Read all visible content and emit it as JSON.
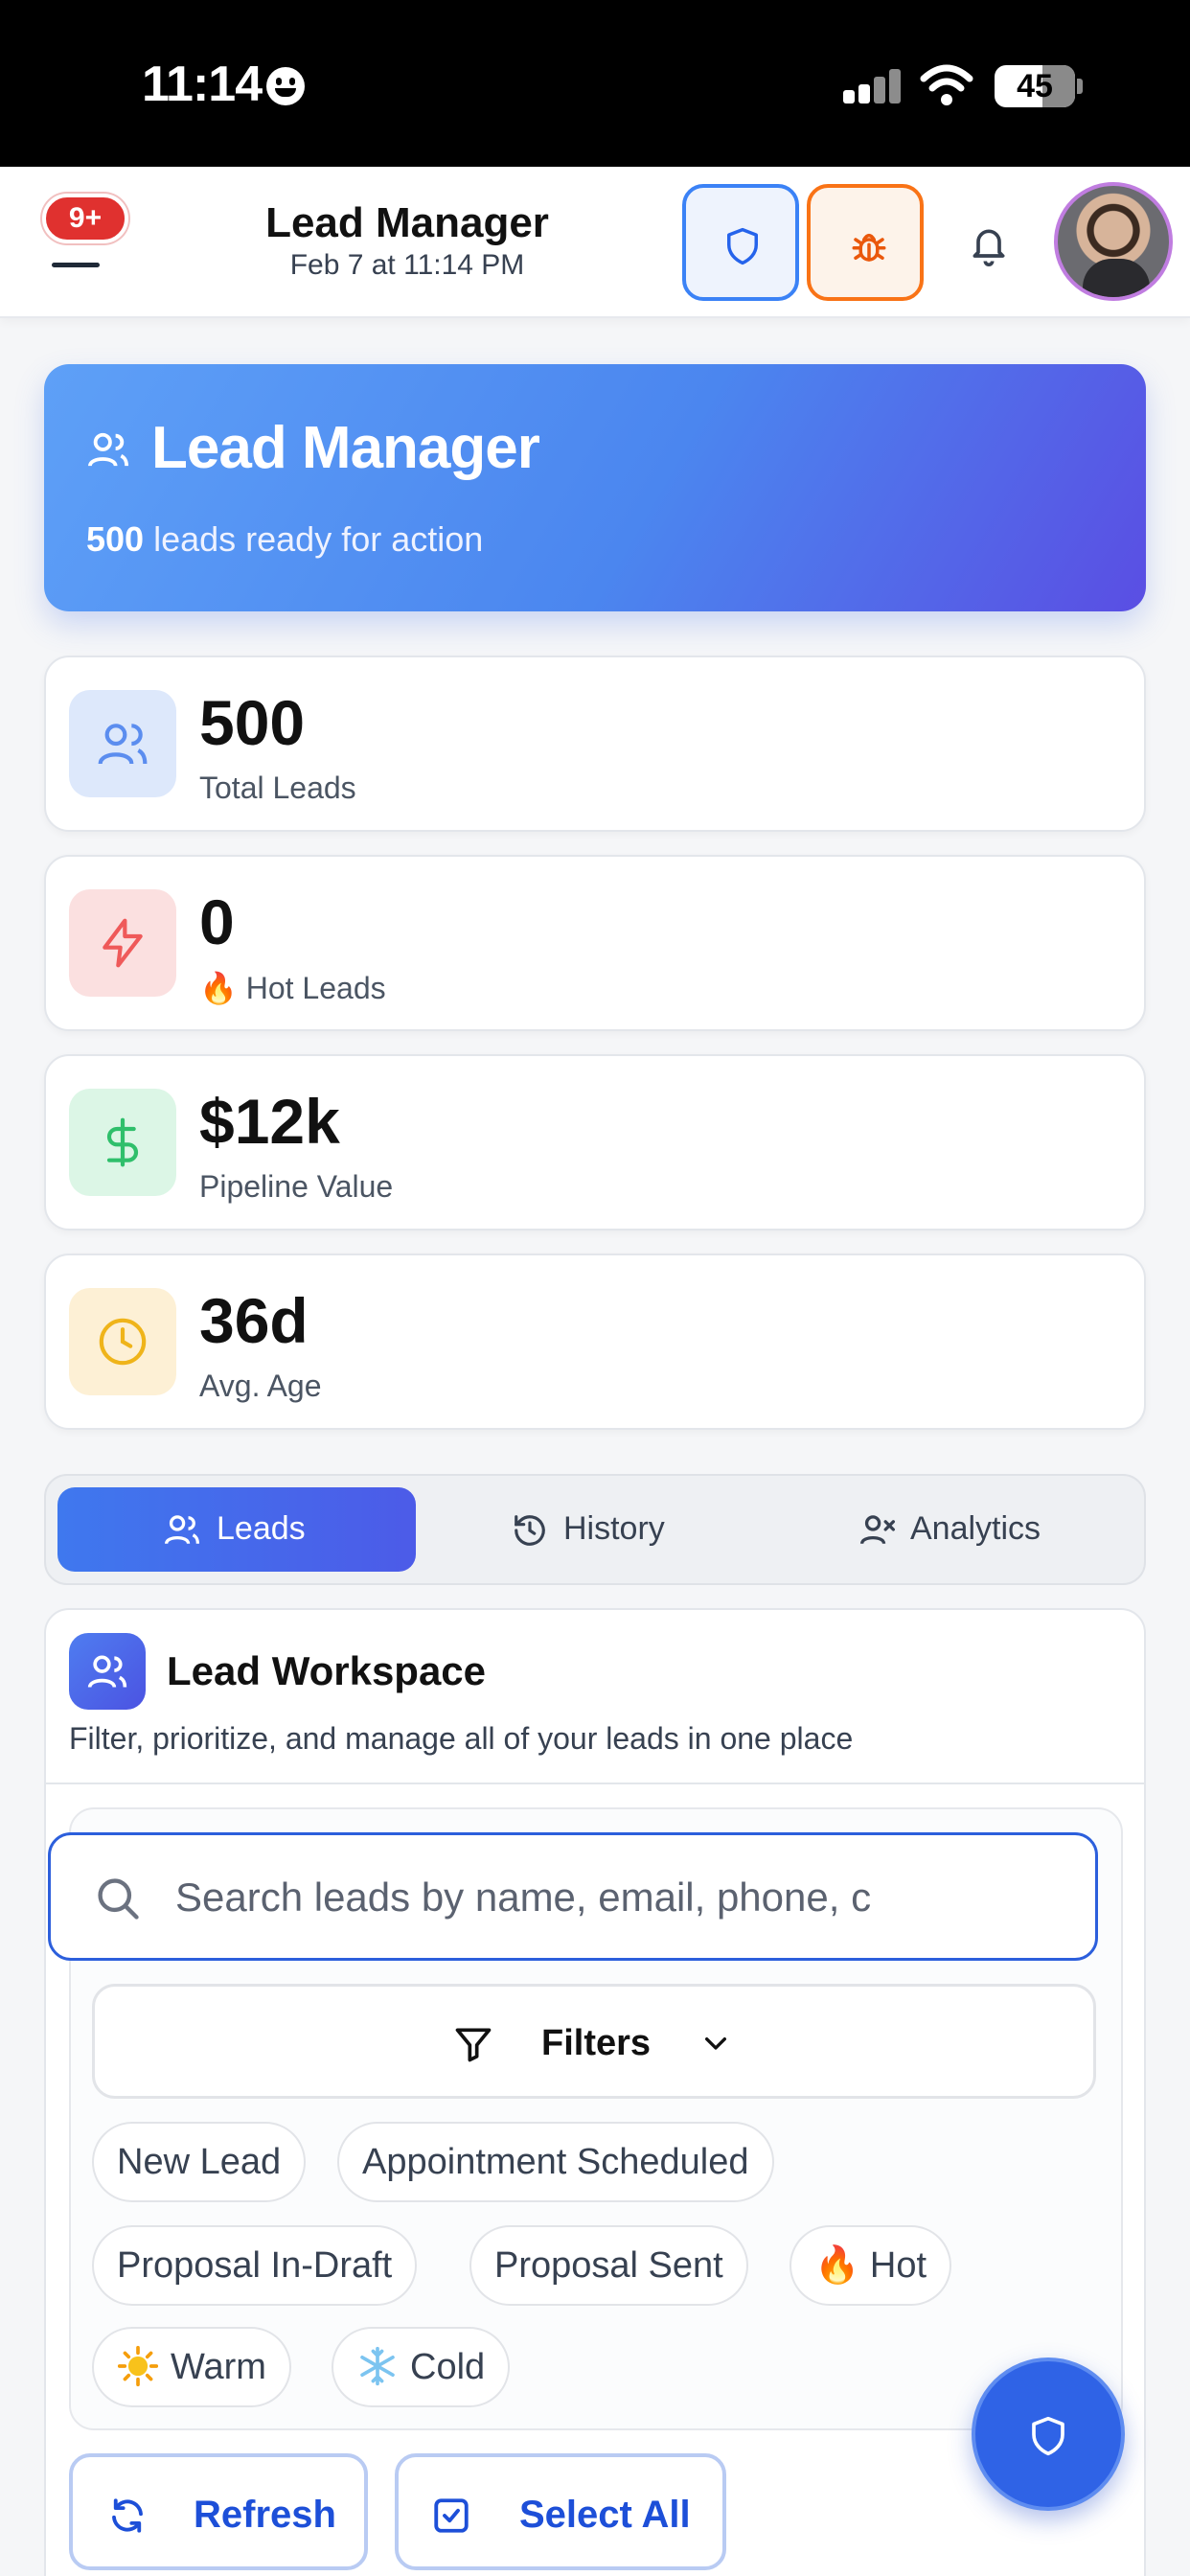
{
  "status_bar": {
    "time": "11:14",
    "battery": "45"
  },
  "header": {
    "notification_count": "9+",
    "title": "Lead Manager",
    "subtitle": "Feb 7 at 11:14 PM",
    "icons": [
      "menu-icon",
      "shield-icon",
      "bug-icon",
      "bell-icon",
      "avatar"
    ]
  },
  "hero": {
    "title": "Lead Manager",
    "count": "500",
    "subtitle_rest": " leads ready for action"
  },
  "stats": [
    {
      "value": "500",
      "label": "Total Leads",
      "icon": "users-icon",
      "color": "#5b8def",
      "bg": "#dde8fb"
    },
    {
      "value": "0",
      "label": "Hot Leads",
      "emoji": "🔥",
      "icon": "zap-icon",
      "color": "#ef5a5a",
      "bg": "#fbe0e0"
    },
    {
      "value": "$12k",
      "label": "Pipeline Value",
      "icon": "dollar-icon",
      "color": "#2fbf6b",
      "bg": "#dcf6e6"
    },
    {
      "value": "36d",
      "label": "Avg. Age",
      "icon": "clock-icon",
      "color": "#efb41a",
      "bg": "#fdf0d5"
    }
  ],
  "tabs": [
    {
      "label": "Leads",
      "active": true
    },
    {
      "label": "History",
      "active": false
    },
    {
      "label": "Analytics",
      "active": false
    }
  ],
  "workspace": {
    "title": "Lead Workspace",
    "subtitle": "Filter, prioritize, and manage all of your leads in one place",
    "search_placeholder": "Search leads by name, email, phone, c",
    "filters_label": "Filters",
    "chips": [
      {
        "label": "New Lead"
      },
      {
        "label": "Appointment Scheduled"
      },
      {
        "label": "Proposal In-Draft"
      },
      {
        "label": "Proposal Sent"
      },
      {
        "label": "Hot",
        "emoji": "🔥"
      },
      {
        "label": "Warm",
        "emoji": "☀️"
      },
      {
        "label": "Cold",
        "emoji": "❄️"
      }
    ],
    "actions": [
      {
        "label": "Refresh"
      },
      {
        "label": "Select All"
      }
    ]
  },
  "colors": {
    "accent": "#3f78ee",
    "hero_start": "#5ea0f7",
    "hero_end": "#5a4ee3",
    "bug_orange": "#f97316"
  }
}
